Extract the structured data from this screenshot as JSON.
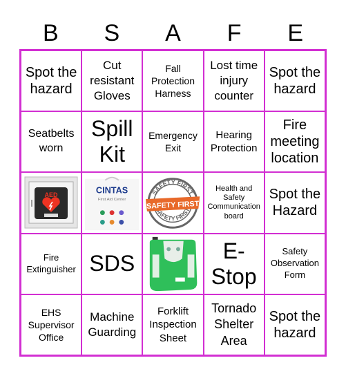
{
  "header": {
    "letters": [
      "B",
      "S",
      "A",
      "F",
      "E"
    ]
  },
  "colors": {
    "grid_border": "#d22ed2",
    "text": "#000000",
    "background": "#ffffff"
  },
  "cells": [
    {
      "row": 0,
      "col": 0,
      "type": "text",
      "text": "Spot the hazard"
    },
    {
      "row": 0,
      "col": 1,
      "type": "text",
      "text": "Cut resistant Gloves"
    },
    {
      "row": 0,
      "col": 2,
      "type": "text",
      "text": "Fall Protection Harness"
    },
    {
      "row": 0,
      "col": 3,
      "type": "text",
      "text": "Lost time injury counter"
    },
    {
      "row": 0,
      "col": 4,
      "type": "text",
      "text": "Spot the hazard"
    },
    {
      "row": 1,
      "col": 0,
      "type": "text",
      "text": "Seatbelts worn"
    },
    {
      "row": 1,
      "col": 1,
      "type": "text",
      "text": "Spill Kit"
    },
    {
      "row": 1,
      "col": 2,
      "type": "text",
      "text": "Emergency Exit"
    },
    {
      "row": 1,
      "col": 3,
      "type": "text",
      "text": "Hearing Protection"
    },
    {
      "row": 1,
      "col": 4,
      "type": "text",
      "text": "Fire meeting location"
    },
    {
      "row": 2,
      "col": 0,
      "type": "image",
      "image": "aed-cabinet-image",
      "caption": "AED"
    },
    {
      "row": 2,
      "col": 1,
      "type": "image",
      "image": "first-aid-center-image",
      "caption": "CINTAS",
      "subcaption": "First Aid Center"
    },
    {
      "row": 2,
      "col": 2,
      "type": "image",
      "image": "safety-first-stamp-image",
      "caption": "SAFETY FIRST"
    },
    {
      "row": 2,
      "col": 3,
      "type": "text",
      "text": "Health and Safety Communication board"
    },
    {
      "row": 2,
      "col": 4,
      "type": "text",
      "text": "Spot the Hazard"
    },
    {
      "row": 3,
      "col": 0,
      "type": "text",
      "text": "Fire Extinguisher"
    },
    {
      "row": 3,
      "col": 1,
      "type": "text",
      "text": "SDS"
    },
    {
      "row": 3,
      "col": 2,
      "type": "image",
      "image": "eyewash-station-image"
    },
    {
      "row": 3,
      "col": 3,
      "type": "text",
      "text": "E-Stop"
    },
    {
      "row": 3,
      "col": 4,
      "type": "text",
      "text": "Safety Observation Form"
    },
    {
      "row": 4,
      "col": 0,
      "type": "text",
      "text": "EHS Supervisor Office"
    },
    {
      "row": 4,
      "col": 1,
      "type": "text",
      "text": "Machine Guarding"
    },
    {
      "row": 4,
      "col": 2,
      "type": "text",
      "text": "Forklift Inspection Sheet"
    },
    {
      "row": 4,
      "col": 3,
      "type": "text",
      "text": "Tornado Shelter Area"
    },
    {
      "row": 4,
      "col": 4,
      "type": "text",
      "text": "Spot the hazard"
    }
  ]
}
